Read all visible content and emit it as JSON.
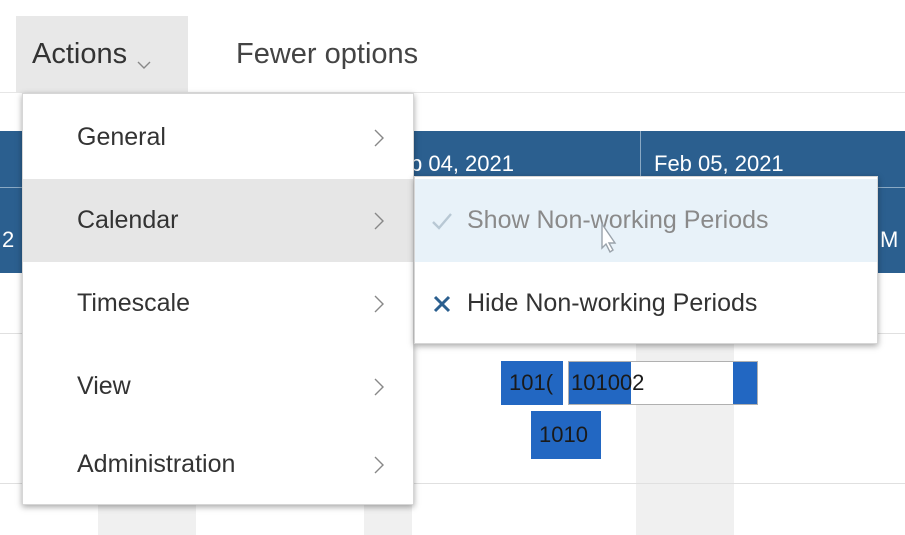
{
  "toolbar": {
    "actions_label": "Actions",
    "fewer_options_label": "Fewer options"
  },
  "gantt": {
    "dates": [
      "b 04, 2021",
      "Feb 05, 2021"
    ],
    "edge_left": "2",
    "edge_right": "M",
    "bars": [
      "101(",
      "101002",
      "1010"
    ]
  },
  "menu": {
    "items": [
      {
        "label": "General"
      },
      {
        "label": "Calendar"
      },
      {
        "label": "Timescale"
      },
      {
        "label": "View"
      },
      {
        "label": "Administration"
      }
    ]
  },
  "submenu": {
    "items": [
      {
        "label": "Show Non-working Periods",
        "icon": "checkmark-icon"
      },
      {
        "label": "Hide Non-working Periods",
        "icon": "x-icon"
      }
    ]
  },
  "colors": {
    "header_blue": "#2b5f8f",
    "bar_blue": "#2267c2",
    "hover_bg": "#e8f2f9",
    "x_icon": "#2b5f8f"
  }
}
